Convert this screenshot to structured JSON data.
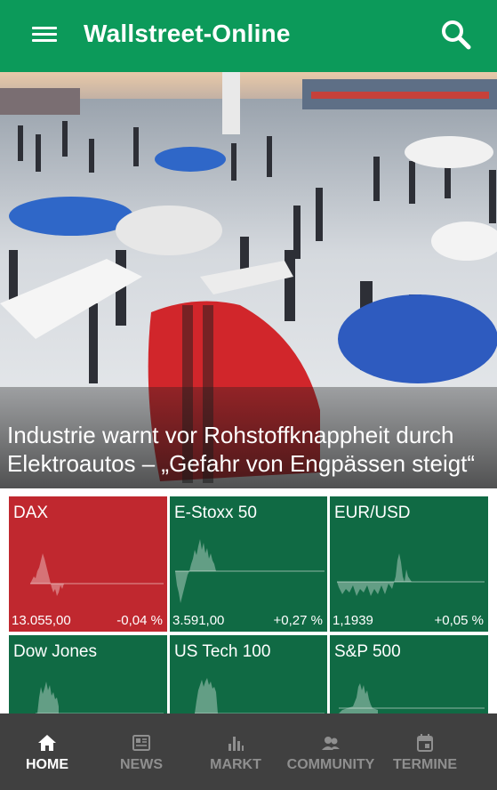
{
  "appbar": {
    "title": "Wallstreet-Online",
    "menu_icon": "hamburger-menu-icon",
    "search_icon": "search-icon",
    "background": "#0c9a5a"
  },
  "hero": {
    "headline": "Industrie warnt vor Rohstoffknappheit durch Elektroautos – „Gefahr von Engpässen steigt“",
    "image": "auto-show-photo"
  },
  "markets": [
    {
      "name": "DAX",
      "price": "13.055,00",
      "change": "-0,04 %",
      "trend": "down",
      "color": "#c0282f"
    },
    {
      "name": "E-Stoxx 50",
      "price": "3.591,00",
      "change": "+0,27 %",
      "trend": "up",
      "color": "#106a44"
    },
    {
      "name": "EUR/USD",
      "price": "1,1939",
      "change": "+0,05 %",
      "trend": "up",
      "color": "#106a44"
    },
    {
      "name": "Dow Jones",
      "price": "",
      "change": "",
      "trend": "up",
      "color": "#106a44"
    },
    {
      "name": "US Tech 100",
      "price": "",
      "change": "",
      "trend": "up",
      "color": "#106a44"
    },
    {
      "name": "S&P 500",
      "price": "",
      "change": "",
      "trend": "up",
      "color": "#106a44"
    }
  ],
  "bottom_nav": {
    "items": [
      {
        "label": "HOME",
        "icon": "home-icon",
        "active": true
      },
      {
        "label": "NEWS",
        "icon": "newspaper-icon",
        "active": false
      },
      {
        "label": "MARKT",
        "icon": "bar-chart-icon",
        "active": false
      },
      {
        "label": "COMMUNITY",
        "icon": "people-icon",
        "active": false
      },
      {
        "label": "TERMINE",
        "icon": "calendar-icon",
        "active": false
      }
    ]
  }
}
